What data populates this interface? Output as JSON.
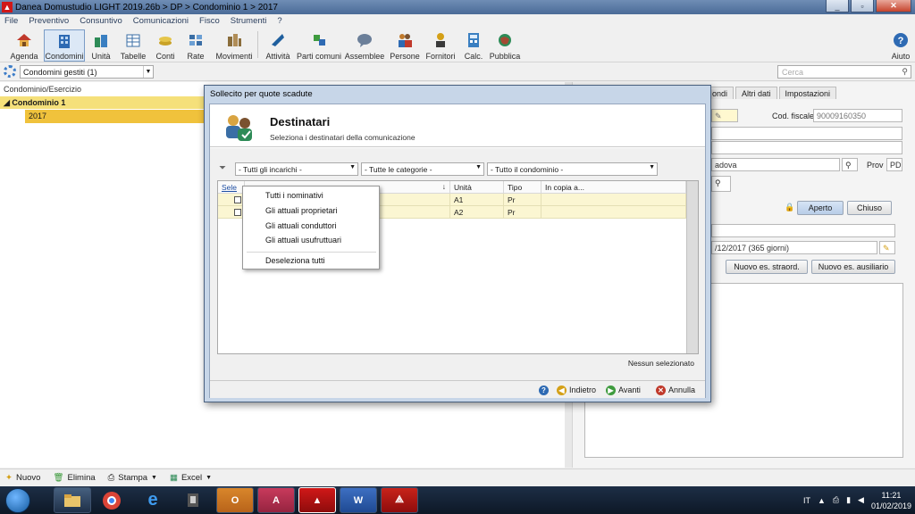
{
  "window": {
    "title": "Danea Domustudio LIGHT 2019.26b > DP > Condominio 1 > 2017",
    "minimize": "_",
    "maximize": "▫",
    "close": "✕"
  },
  "menu": [
    "File",
    "Preventivo",
    "Consuntivo",
    "Comunicazioni",
    "Fisco",
    "Strumenti",
    "?"
  ],
  "toolbar": {
    "items": [
      {
        "label": "Agenda",
        "icon": "house-icon",
        "color": "#c0392b"
      },
      {
        "label": "Condomini",
        "icon": "building-icon",
        "color": "#2e6ab3"
      },
      {
        "label": "Unità",
        "icon": "unit-icon",
        "color": "#2e8b57"
      },
      {
        "label": "Tabelle",
        "icon": "table-icon",
        "color": "#3a6ea5"
      },
      {
        "label": "Conti",
        "icon": "coins-icon",
        "color": "#c9a227"
      },
      {
        "label": "Rate",
        "icon": "rate-icon",
        "color": "#3a6ea5"
      },
      {
        "label": "Movimenti",
        "icon": "movements-icon",
        "color": "#8a6d3b"
      },
      {
        "label": "Attività",
        "icon": "activity-icon",
        "color": "#1f5f9e"
      },
      {
        "label": "Parti comuni",
        "icon": "puzzle-icon",
        "color": "#3e9b3e"
      },
      {
        "label": "Assemblee",
        "icon": "speech-icon",
        "color": "#6b7f99"
      },
      {
        "label": "Persone",
        "icon": "people-icon",
        "color": "#c07a2c"
      },
      {
        "label": "Fornitori",
        "icon": "supplier-icon",
        "color": "#d4a017"
      },
      {
        "label": "Calc.",
        "icon": "calculator-icon",
        "color": "#3a7fc1"
      },
      {
        "label": "Pubblica",
        "icon": "globe-icon",
        "color": "#2e8b57"
      }
    ],
    "help_label": "Aiuto"
  },
  "bar2": {
    "combo_value": "Condomini gestiti (1)",
    "search_placeholder": "Cerca"
  },
  "tree": {
    "header": "Condominio/Esercizio",
    "node": "Condominio 1",
    "child": "2017"
  },
  "right_panel": {
    "tabs": [
      "ondi",
      "Altri dati",
      "Impostazioni"
    ],
    "cod_fiscale_label": "Cod. fiscale",
    "cod_fiscale_value": "90009160350",
    "city_value": "adova",
    "prov_label": "Prov",
    "prov_value": "PD",
    "aperto": "Aperto",
    "chiuso": "Chiuso",
    "period": "/12/2017  (365 giorni)",
    "btn_straord": "Nuovo es. straord.",
    "btn_ausiliario": "Nuovo es. ausiliario"
  },
  "dialog": {
    "title": "Sollecito per quote scadute",
    "header_title": "Destinatari",
    "header_subtitle": "Seleziona i destinatari della comunicazione",
    "filters": [
      "- Tutti gli incarichi -",
      "- Tutte le categorie -",
      "- Tutto il condominio -"
    ],
    "columns": {
      "sel": "Sele",
      "name": "",
      "unita": "Unità",
      "tipo": "Tipo",
      "copia": "In copia a..."
    },
    "rows": [
      {
        "unita": "A1",
        "tipo": "Pr"
      },
      {
        "unita": "A2",
        "tipo": "Pr"
      }
    ],
    "status": "Nessun selezionato",
    "buttons": {
      "help": "?",
      "back": "Indietro",
      "next": "Avanti",
      "cancel": "Annulla"
    }
  },
  "context_menu": {
    "items": [
      "Tutti i nominativi",
      "Gli attuali proprietari",
      "Gli attuali conduttori",
      "Gli attuali usufruttuari"
    ],
    "deselect": "Deseleziona tutti"
  },
  "bottombar": {
    "nuovo": "Nuovo",
    "elimina": "Elimina",
    "stampa": "Stampa",
    "excel": "Excel"
  },
  "taskbar": {
    "lang": "IT",
    "time": "11:21",
    "date": "01/02/2019"
  }
}
